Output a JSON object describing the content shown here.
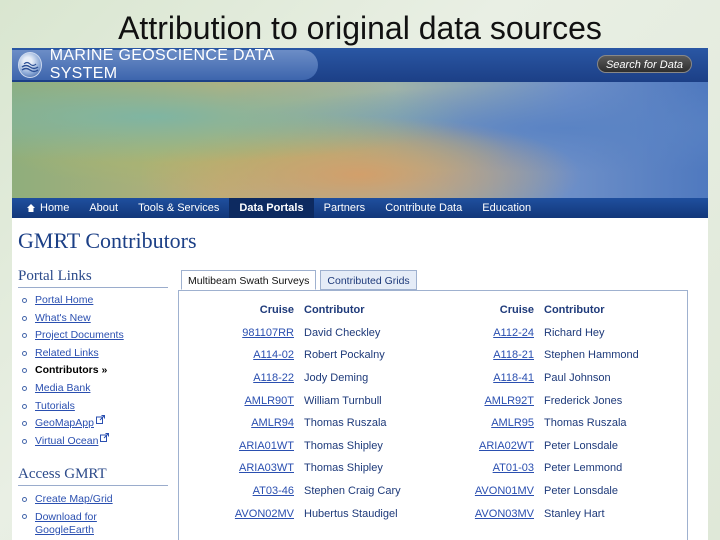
{
  "slide": {
    "title": "Attribution to original data sources"
  },
  "header": {
    "logo_text": "MARINE GEOSCIENCE DATA SYSTEM",
    "search_label": "Search for Data"
  },
  "nav": {
    "items": [
      {
        "label": "Home"
      },
      {
        "label": "About"
      },
      {
        "label": "Tools & Services"
      },
      {
        "label": "Data Portals",
        "active": true
      },
      {
        "label": "Partners"
      },
      {
        "label": "Contribute Data"
      },
      {
        "label": "Education"
      }
    ]
  },
  "page": {
    "title": "GMRT Contributors"
  },
  "portal_links": {
    "heading": "Portal Links",
    "items": [
      {
        "label": "Portal Home"
      },
      {
        "label": "What's New"
      },
      {
        "label": "Project Documents"
      },
      {
        "label": "Related Links"
      },
      {
        "label": "Contributors »",
        "current": true
      },
      {
        "label": "Media Bank"
      },
      {
        "label": "Tutorials"
      },
      {
        "label": "GeoMapApp",
        "external": true
      },
      {
        "label": "Virtual Ocean",
        "external": true
      }
    ]
  },
  "access": {
    "heading": "Access GMRT",
    "items": [
      {
        "label": "Create Map/Grid"
      },
      {
        "label": "Download for GoogleEarth"
      }
    ]
  },
  "tabs": [
    {
      "label": "Multibeam Swath Surveys",
      "active": true
    },
    {
      "label": "Contributed Grids"
    }
  ],
  "table": {
    "headers": {
      "cruise": "Cruise",
      "contributor": "Contributor"
    },
    "rows": [
      {
        "c1": "981107RR",
        "n1": "David Checkley",
        "c2": "A112-24",
        "n2": "Richard Hey"
      },
      {
        "c1": "A114-02",
        "n1": "Robert Pockalny",
        "c2": "A118-21",
        "n2": "Stephen Hammond"
      },
      {
        "c1": "A118-22",
        "n1": "Jody Deming",
        "c2": "A118-41",
        "n2": "Paul Johnson"
      },
      {
        "c1": "AMLR90T",
        "n1": "William Turnbull",
        "c2": "AMLR92T",
        "n2": "Frederick Jones"
      },
      {
        "c1": "AMLR94",
        "n1": "Thomas Ruszala",
        "c2": "AMLR95",
        "n2": "Thomas Ruszala"
      },
      {
        "c1": "ARIA01WT",
        "n1": "Thomas Shipley",
        "c2": "ARIA02WT",
        "n2": "Peter Lonsdale"
      },
      {
        "c1": "ARIA03WT",
        "n1": "Thomas Shipley",
        "c2": "AT01-03",
        "n2": "Peter Lemmond"
      },
      {
        "c1": "AT03-46",
        "n1": "Stephen Craig Cary",
        "c2": "AVON01MV",
        "n2": "Peter Lonsdale"
      },
      {
        "c1": "AVON02MV",
        "n1": "Hubertus Staudigel",
        "c2": "AVON03MV",
        "n2": "Stanley Hart"
      }
    ]
  }
}
